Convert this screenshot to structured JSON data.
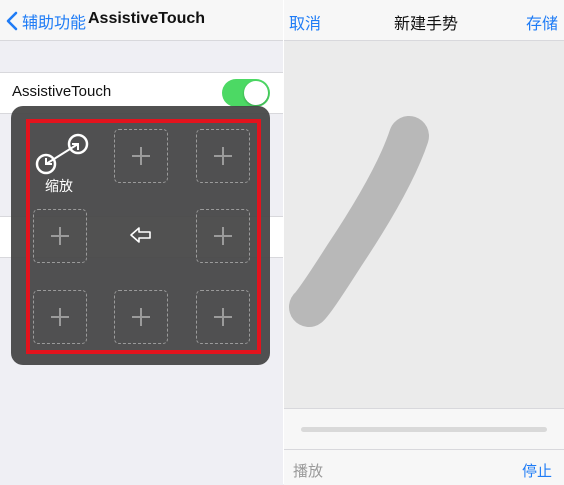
{
  "left_screen": {
    "nav": {
      "back_label": "辅助功能",
      "title": "AssistiveTouch"
    },
    "assistive_row": {
      "label": "AssistiveTouch",
      "toggle_on": true
    },
    "panel": {
      "zoom_label": "缩放",
      "empty_slot_icon": "plus-icon",
      "back_icon": "arrow-left-icon"
    },
    "colors": {
      "accent": "#1f7cf6",
      "toggle_on": "#4cd964",
      "highlight_frame": "#e3131d"
    }
  },
  "right_screen": {
    "nav": {
      "cancel_label": "取消",
      "title": "新建手势",
      "save_label": "存储"
    },
    "controls": {
      "play_label": "播放",
      "stop_label": "停止"
    }
  }
}
